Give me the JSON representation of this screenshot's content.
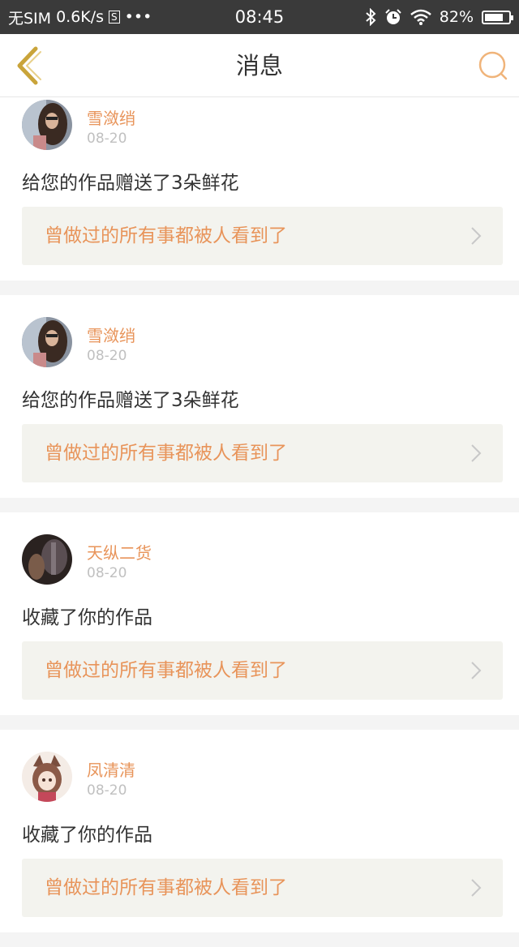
{
  "status_bar": {
    "carrier": "无SIM",
    "net_speed": "0.6K/s",
    "s_badge": "S",
    "dots": "•••",
    "time": "08:45",
    "battery_text": "82%",
    "battery_level": 0.82,
    "icons": [
      "bluetooth-icon",
      "alarm-icon",
      "wifi-icon",
      "battery-icon"
    ]
  },
  "nav": {
    "title": "消息",
    "back_icon": "chevron-left-icon",
    "search_icon": "search-icon",
    "accent_color": "#f0b47a"
  },
  "messages": [
    {
      "user": "雪潋绡",
      "date": "08-20",
      "action": "给您的作品赠送了3朵鲜花",
      "work_title": "曾做过的所有事都被人看到了",
      "avatar": "avatar-photo-girl"
    },
    {
      "user": "雪潋绡",
      "date": "08-20",
      "action": "给您的作品赠送了3朵鲜花",
      "work_title": "曾做过的所有事都被人看到了",
      "avatar": "avatar-photo-girl"
    },
    {
      "user": "天纵二货",
      "date": "08-20",
      "action": "收藏了你的作品",
      "work_title": "曾做过的所有事都被人看到了",
      "avatar": "avatar-photo-dark"
    },
    {
      "user": "凤清清",
      "date": "08-20",
      "action": "收藏了你的作品",
      "work_title": "曾做过的所有事都被人看到了",
      "avatar": "avatar-anime"
    }
  ],
  "colors": {
    "name_accent": "#e8945a",
    "date_gray": "#c0c0c0",
    "work_bg": "#f3f3ee",
    "page_bg": "#f4f4f4",
    "back_icon": "#c9a43a"
  }
}
